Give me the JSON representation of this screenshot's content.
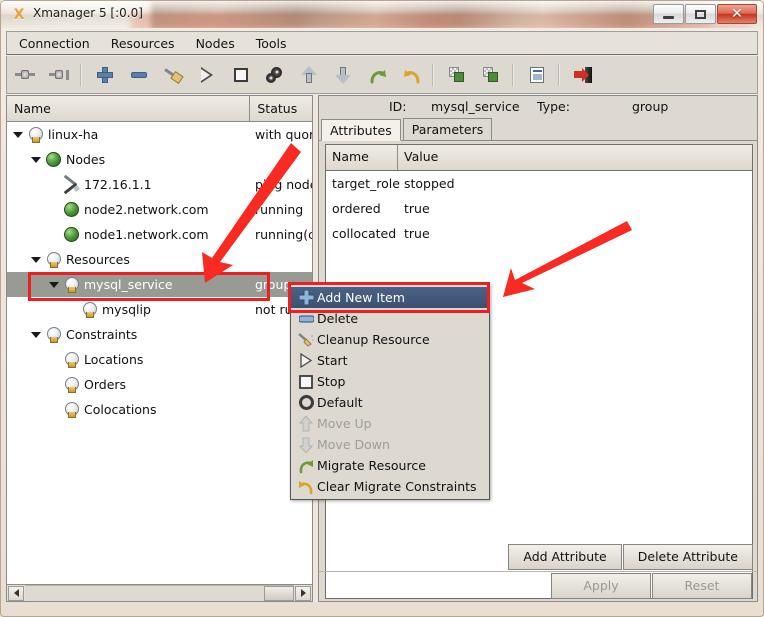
{
  "window": {
    "title": "Xmanager 5 [:0.0]",
    "app_icon": "xmanager-icon",
    "minimize": "–",
    "maximize": "□",
    "close": "✕"
  },
  "menubar": {
    "items": [
      {
        "label": "Connection",
        "name": "menu-connection"
      },
      {
        "label": "Resources",
        "name": "menu-resources"
      },
      {
        "label": "Nodes",
        "name": "menu-nodes"
      },
      {
        "label": "Tools",
        "name": "menu-tools"
      }
    ]
  },
  "toolbar": {
    "buttons": [
      {
        "name": "connect-icon",
        "title": "Connect"
      },
      {
        "name": "disconnect-icon",
        "title": "Disconnect"
      },
      {
        "name": "add-icon",
        "title": "Add"
      },
      {
        "name": "remove-icon",
        "title": "Remove"
      },
      {
        "name": "cleanup-icon",
        "title": "Cleanup Resource"
      },
      {
        "name": "start-icon",
        "title": "Start"
      },
      {
        "name": "stop-icon",
        "title": "Stop"
      },
      {
        "name": "default-icon",
        "title": "Default"
      },
      {
        "name": "move-up-icon",
        "title": "Move Up"
      },
      {
        "name": "move-down-icon",
        "title": "Move Down"
      },
      {
        "name": "migrate-resource-icon",
        "title": "Migrate Resource"
      },
      {
        "name": "clear-migrate-constraints-icon",
        "title": "Clear Migrate Constraints"
      },
      {
        "name": "copy-icon",
        "title": "Copy"
      },
      {
        "name": "paste-icon",
        "title": "Paste"
      },
      {
        "name": "report-icon",
        "title": "Report"
      },
      {
        "name": "exit-icon",
        "title": "Exit"
      }
    ]
  },
  "tree": {
    "columns": [
      "Name",
      "Status"
    ],
    "rows": [
      {
        "label": "linux-ha",
        "status": "with quor",
        "indent": 0,
        "icon": "bulb-icon",
        "twisty": "expanded",
        "selected": false
      },
      {
        "label": "Nodes",
        "status": "",
        "indent": 1,
        "icon": "globe-icon",
        "twisty": "expanded",
        "selected": false
      },
      {
        "label": "172.16.1.1",
        "status": "ping node",
        "indent": 2,
        "icon": "tools-icon",
        "twisty": "none",
        "selected": false
      },
      {
        "label": "node2.network.com",
        "status": "running",
        "indent": 2,
        "icon": "globe-icon",
        "twisty": "none",
        "selected": false
      },
      {
        "label": "node1.network.com",
        "status": "running(c",
        "indent": 2,
        "icon": "globe-icon",
        "twisty": "none",
        "selected": false
      },
      {
        "label": "Resources",
        "status": "",
        "indent": 1,
        "icon": "bulb-icon",
        "twisty": "expanded",
        "selected": false
      },
      {
        "label": "mysql_service",
        "status": "group",
        "indent": 2,
        "icon": "bulb-icon",
        "twisty": "expanded",
        "selected": true
      },
      {
        "label": "mysqlip",
        "status": "not ru",
        "indent": 3,
        "icon": "bulb-icon",
        "twisty": "none",
        "selected": false
      },
      {
        "label": "Constraints",
        "status": "",
        "indent": 1,
        "icon": "bulb-icon",
        "twisty": "expanded",
        "selected": false
      },
      {
        "label": "Locations",
        "status": "",
        "indent": 2,
        "icon": "bulb-icon",
        "twisty": "none",
        "selected": false
      },
      {
        "label": "Orders",
        "status": "",
        "indent": 2,
        "icon": "bulb-icon",
        "twisty": "none",
        "selected": false
      },
      {
        "label": "Colocations",
        "status": "",
        "indent": 2,
        "icon": "bulb-icon",
        "twisty": "none",
        "selected": false
      }
    ]
  },
  "details": {
    "id_label": "ID:",
    "id_value": "mysql_service",
    "type_label": "Type:",
    "type_value": "group",
    "tabs": [
      {
        "label": "Attributes",
        "active": true
      },
      {
        "label": "Parameters",
        "active": false
      }
    ],
    "table": {
      "columns": [
        "Name",
        "Value"
      ],
      "rows": [
        {
          "name": "target_role",
          "value": "stopped"
        },
        {
          "name": "ordered",
          "value": "true"
        },
        {
          "name": "collocated",
          "value": "true"
        }
      ]
    },
    "buttons": {
      "add_attribute": "Add Attribute",
      "delete_attribute": "Delete Attribute",
      "apply": "Apply",
      "reset": "Reset"
    }
  },
  "context_menu": {
    "items": [
      {
        "label": "Add New Item",
        "icon": "plus-icon",
        "state": "highlighted"
      },
      {
        "label": "Delete",
        "icon": "minus-icon",
        "state": "normal"
      },
      {
        "label": "Cleanup Resource",
        "icon": "broom-icon",
        "state": "normal"
      },
      {
        "label": "Start",
        "icon": "play-icon",
        "state": "normal"
      },
      {
        "label": "Stop",
        "icon": "stop-icon",
        "state": "normal"
      },
      {
        "label": "Default",
        "icon": "gear-icon",
        "state": "normal"
      },
      {
        "label": "Move Up",
        "icon": "arrow-up-icon",
        "state": "disabled"
      },
      {
        "label": "Move Down",
        "icon": "arrow-down-icon",
        "state": "disabled"
      },
      {
        "label": "Migrate Resource",
        "icon": "migrate-icon",
        "state": "normal"
      },
      {
        "label": "Clear Migrate Constraints",
        "icon": "undo-icon",
        "state": "normal"
      }
    ]
  },
  "annotations": {
    "accent_color": "#f01f1f",
    "highlight_boxes": [
      {
        "name": "mysql-service-row-highlight"
      },
      {
        "name": "add-new-item-highlight"
      }
    ],
    "arrows": [
      {
        "name": "arrow-to-mysql-service"
      },
      {
        "name": "arrow-to-add-new-item"
      }
    ]
  },
  "scrollbar": {
    "left_arrow": "◀",
    "right_arrow": "▶"
  }
}
